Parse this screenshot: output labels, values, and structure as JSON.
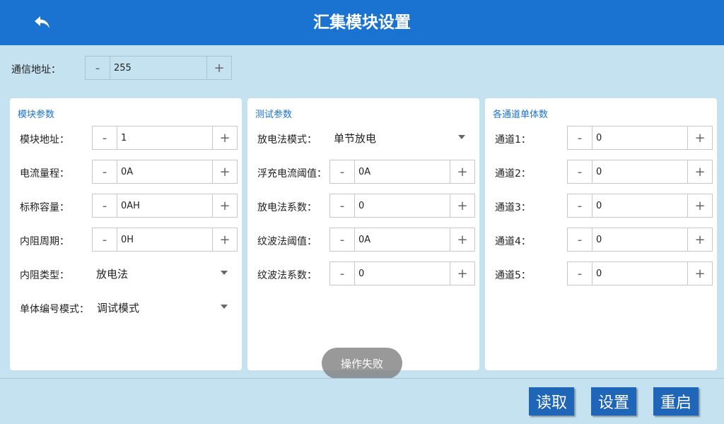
{
  "header": {
    "title": "汇集模块设置",
    "back_icon": "back-arrow-icon"
  },
  "comm_address": {
    "label": "通信地址：",
    "value": "255",
    "minus": "-",
    "plus": "+"
  },
  "module_params": {
    "title": "模块参数",
    "fields": [
      {
        "label": "模块地址：",
        "value": "1",
        "minus": "-",
        "plus": "+"
      },
      {
        "label": "电流量程：",
        "value": "0A",
        "minus": "-",
        "plus": "+"
      },
      {
        "label": "标称容量：",
        "value": "0AH",
        "minus": "-",
        "plus": "+"
      },
      {
        "label": "内阻周期：",
        "value": "0H",
        "minus": "-",
        "plus": "+"
      }
    ],
    "selects": [
      {
        "label": "内阻类型：",
        "value": "放电法"
      },
      {
        "label": "单体编号模式：",
        "value": "调试模式"
      }
    ]
  },
  "test_params": {
    "title": "测试参数",
    "select": {
      "label": "放电法模式：",
      "value": "单节放电"
    },
    "fields": [
      {
        "label": "浮充电流阈值：",
        "value": "0A",
        "minus": "-",
        "plus": "+"
      },
      {
        "label": "放电法系数：",
        "value": "0",
        "minus": "-",
        "plus": "+"
      },
      {
        "label": "纹波法阈值：",
        "value": "0A",
        "minus": "-",
        "plus": "+"
      },
      {
        "label": "纹波法系数：",
        "value": "0",
        "minus": "-",
        "plus": "+"
      }
    ]
  },
  "channel_counts": {
    "title": "各通道单体数",
    "fields": [
      {
        "label": "通道1：",
        "value": "0",
        "minus": "-",
        "plus": "+"
      },
      {
        "label": "通道2：",
        "value": "0",
        "minus": "-",
        "plus": "+"
      },
      {
        "label": "通道3：",
        "value": "0",
        "minus": "-",
        "plus": "+"
      },
      {
        "label": "通道4：",
        "value": "0",
        "minus": "-",
        "plus": "+"
      },
      {
        "label": "通道5：",
        "value": "0",
        "minus": "-",
        "plus": "+"
      }
    ]
  },
  "toast": "操作失败",
  "buttons": {
    "read": "读取",
    "set": "设置",
    "restart": "重启"
  },
  "colors": {
    "header": "#1a73d1",
    "background": "#c5e2f1",
    "button": "#1f65b8",
    "accent_text": "#1a73d1"
  }
}
